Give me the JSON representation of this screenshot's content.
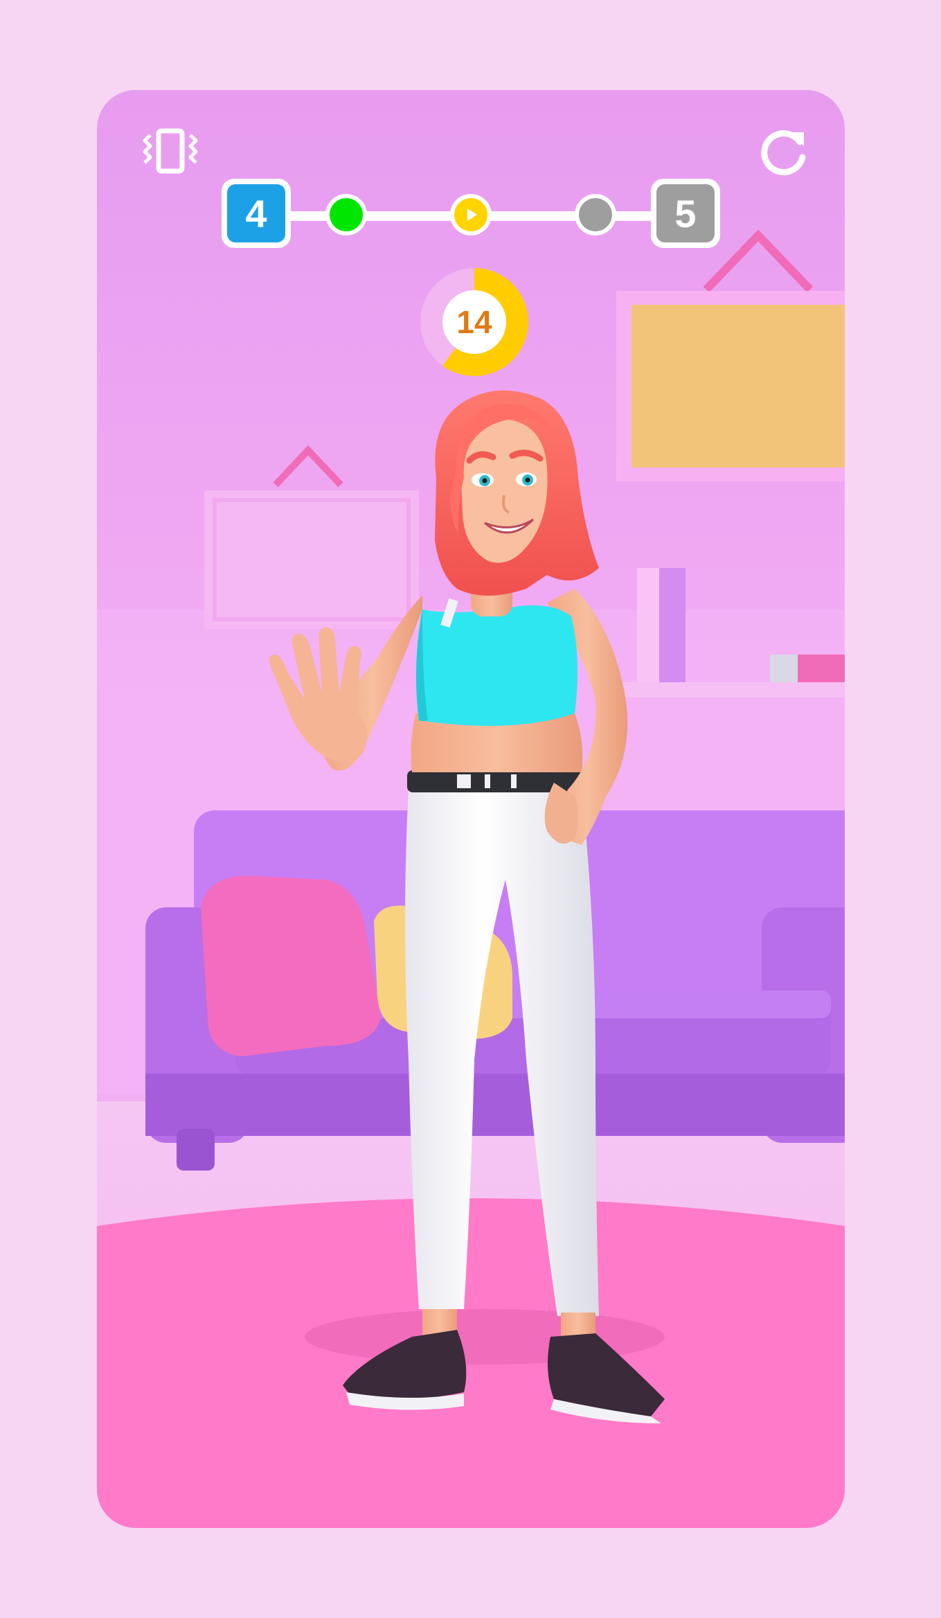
{
  "hud": {
    "vibrate_icon": "vibrate-phone-icon",
    "restart_icon": "restart-arrow-icon"
  },
  "level_progress": {
    "current_level": "4",
    "next_level": "5",
    "stages": [
      {
        "state": "completed",
        "color": "#00e600"
      },
      {
        "state": "current",
        "color": "#ffd400",
        "icon": "play-icon"
      },
      {
        "state": "locked",
        "color": "#9e9e9e"
      }
    ],
    "current_color": "#1da1e6",
    "next_color": "#9e9e9e"
  },
  "timer": {
    "value": "14",
    "remaining_fraction": 0.6,
    "ring_color": "#ffcc00",
    "text_color": "#e07a14"
  },
  "colors": {
    "page_background": "#f6d6f3",
    "wall": "#e79cf0",
    "floor_rug": "#ff7ac8",
    "sofa": "#c77ef5"
  }
}
